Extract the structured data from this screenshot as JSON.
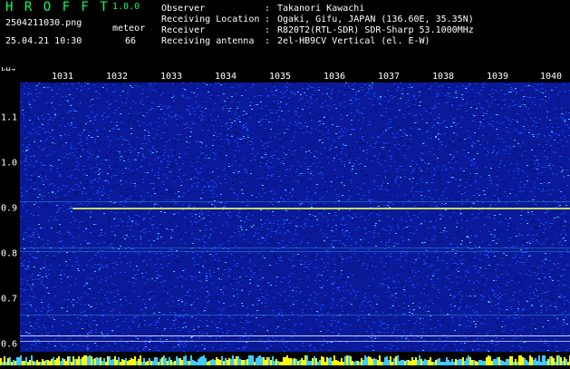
{
  "header": {
    "app_title": "H R O F F T",
    "app_version": "1.0.0",
    "file_name": "2504211030.png",
    "meteor_label": "meteor",
    "datetime": "25.04.21 10:30",
    "meteor_count": "66",
    "info": [
      {
        "key": "Observer",
        "value": "Takanori Kawachi"
      },
      {
        "key": "Receiving Location",
        "value": "Ogaki, Gifu, JAPAN (136.60E, 35.35N)"
      },
      {
        "key": "Receiver",
        "value": "R820T2(RTL-SDR) SDR-Sharp 53.1000MHz"
      },
      {
        "key": "Receiving antenna",
        "value": "2el-HB9CV Vertical (el. E-W)"
      }
    ]
  },
  "spectrogram": {
    "unit_label": "kHz",
    "time_ticks": [
      "1031",
      "1032",
      "1033",
      "1034",
      "1035",
      "1036",
      "1037",
      "1038",
      "1039",
      "1040"
    ],
    "freq_ticks": [
      "1.1",
      "1.0",
      "0.9",
      "0.8",
      "0.7",
      "0.6"
    ],
    "colors": {
      "background": "#000000",
      "noise_low": "#0a1a9a",
      "noise_mid": "#1a4aff",
      "noise_high": "#40c8ff",
      "signal": "#d8f060",
      "grid": "#ffffff"
    }
  }
}
